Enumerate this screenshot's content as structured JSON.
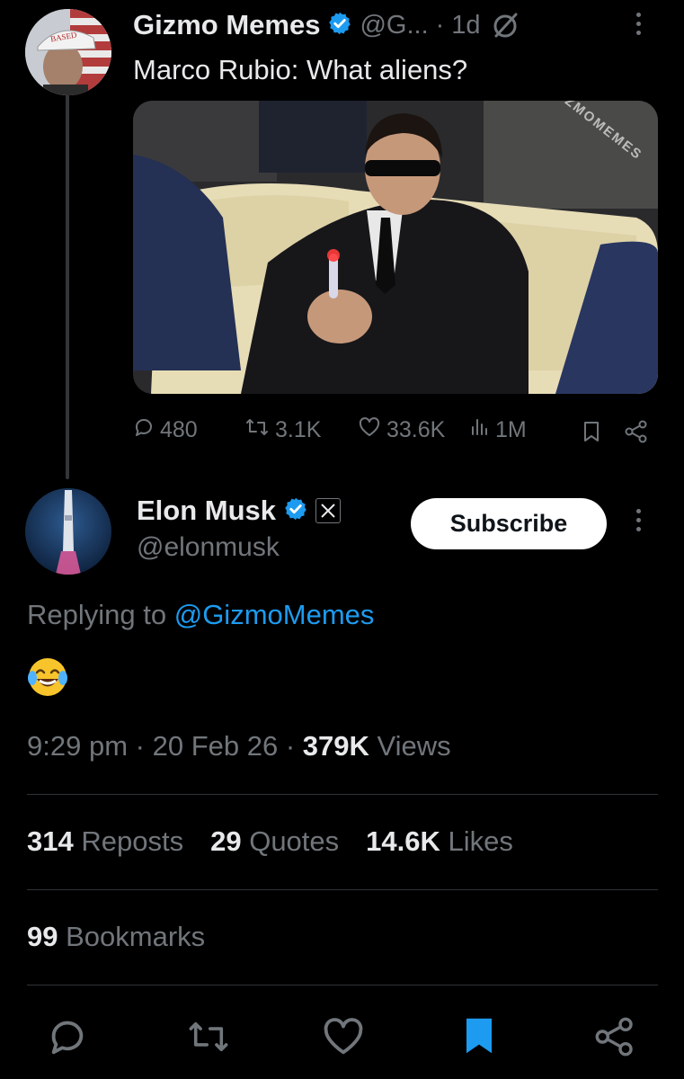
{
  "original_tweet": {
    "author_name": "Gizmo Memes",
    "handle_truncated": "@G...",
    "separator": "·",
    "age": "1d",
    "text": "Marco Rubio: What aliens?",
    "avatar_cap_text": "BASED",
    "media_watermark": "@GIZMOMEMES",
    "metrics": {
      "replies": "480",
      "reposts": "3.1K",
      "likes": "33.6K",
      "views": "1M"
    }
  },
  "reply_tweet": {
    "author_name": "Elon Musk",
    "handle": "@elonmusk",
    "subscribe_label": "Subscribe",
    "replying_prefix": "Replying to",
    "replying_handle": "@GizmoMemes",
    "emoji": "😂",
    "time": "9:29 pm",
    "dot1": "·",
    "date": "20 Feb 26",
    "dot2": "·",
    "views_count": "379K",
    "views_label": "Views",
    "stats": {
      "reposts_count": "314",
      "reposts_label": "Reposts",
      "quotes_count": "29",
      "quotes_label": "Quotes",
      "likes_count": "14.6K",
      "likes_label": "Likes",
      "bookmarks_count": "99",
      "bookmarks_label": "Bookmarks"
    }
  },
  "icons": {
    "verified": "verified-badge-icon",
    "grok": "grok-icon",
    "more": "more-options-icon",
    "reply": "reply-icon",
    "repost": "repost-icon",
    "like": "heart-icon",
    "views": "views-bar-icon",
    "bookmark": "bookmark-icon",
    "share": "share-icon",
    "x_affiliation": "x-logo-icon"
  },
  "colors": {
    "background": "#000000",
    "text_primary": "#e7e9ea",
    "text_muted": "#71767b",
    "accent_blue": "#1d9bf0",
    "divider": "#2f3336"
  }
}
